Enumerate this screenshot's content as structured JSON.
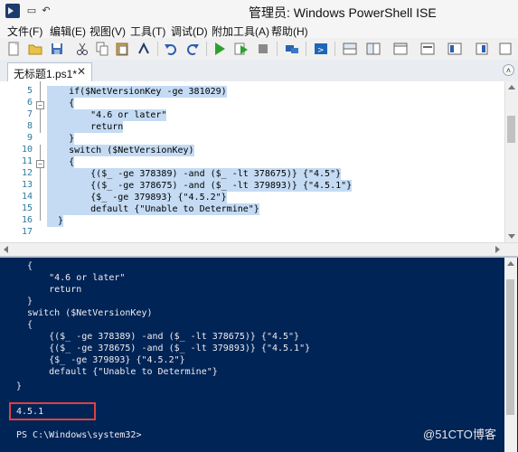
{
  "window": {
    "title": "管理员: Windows PowerShell ISE"
  },
  "menu": [
    "文件(F)",
    "编辑(E)",
    "视图(V)",
    "工具(T)",
    "调试(D)",
    "附加工具(A)",
    "帮助(H)"
  ],
  "toolbar_icons": [
    "new-file-icon",
    "open-folder-icon",
    "save-icon",
    "cut-icon",
    "copy-icon",
    "paste-icon",
    "powershell-prompt-icon",
    "undo-icon",
    "redo-icon",
    "run-icon",
    "run-selection-icon",
    "stop-icon",
    "remote-powershell-icon",
    "powershell-console-icon",
    "layout-top-icon",
    "layout-right-icon",
    "layout-max-icon",
    "show-commands-icon",
    "addon-icon"
  ],
  "tab": {
    "label": "无标题1.ps1*",
    "close": "✕"
  },
  "editor": {
    "lines": [
      {
        "num": "5",
        "code": "    if($NetVersionKey -ge 381029)"
      },
      {
        "num": "6",
        "code": "    {"
      },
      {
        "num": "7",
        "code": "        \"4.6 or later\""
      },
      {
        "num": "8",
        "code": "        return"
      },
      {
        "num": "9",
        "code": "    }"
      },
      {
        "num": "10",
        "code": "    switch ($NetVersionKey)"
      },
      {
        "num": "11",
        "code": "    {"
      },
      {
        "num": "12",
        "code": "        {($_ -ge 378389) -and ($_ -lt 378675)} {\"4.5\"}"
      },
      {
        "num": "13",
        "code": "        {($_ -ge 378675) -and ($_ -lt 379893)} {\"4.5.1\"}"
      },
      {
        "num": "14",
        "code": "        {$_ -ge 379893} {\"4.5.2\"}"
      },
      {
        "num": "15",
        "code": "        default {\"Unable to Determine\"}"
      },
      {
        "num": "16",
        "code": "  }"
      },
      {
        "num": "17",
        "code": ""
      }
    ]
  },
  "console": {
    "lines": [
      "  {",
      "      \"4.6 or later\"",
      "      return",
      "  }",
      "  switch ($NetVersionKey)",
      "  {",
      "      {($_ -ge 378389) -and ($_ -lt 378675)} {\"4.5\"}",
      "      {($_ -ge 378675) -and ($_ -lt 379893)} {\"4.5.1\"}",
      "      {$_ -ge 379893} {\"4.5.2\"}",
      "      default {\"Unable to Determine\"}",
      "}"
    ],
    "result": "4.5.1",
    "prompt": "PS C:\\Windows\\system32>"
  },
  "watermark": "@51CTO博客",
  "colors": {
    "console_bg": "#012456",
    "selection": "#c4dbf3",
    "highlight_box": "#e04040"
  }
}
